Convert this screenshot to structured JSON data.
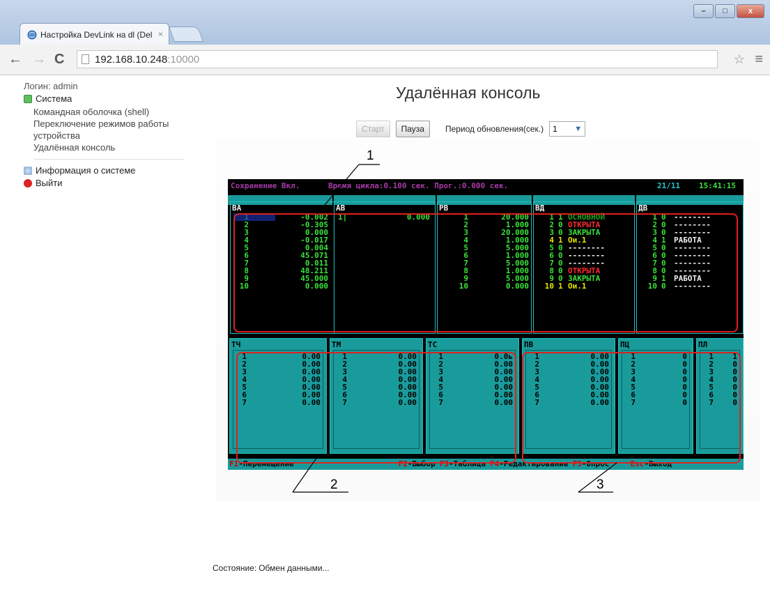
{
  "browser": {
    "tab_title": "Настройка DevLink на dl (Del",
    "tab_close": "×",
    "address_host": "192.168.10.248",
    "address_port": ":10000",
    "window_buttons": [
      "–",
      "□",
      "x"
    ]
  },
  "sidebar": {
    "login": "Логин: admin",
    "system_label": "Система",
    "items": [
      "Командная оболочка (shell)",
      "Переключение режимов работы устройства",
      "Удалённая консоль"
    ],
    "info_label": "Информация о системе",
    "logout_label": "Выйти"
  },
  "main": {
    "title": "Удалённая консоль",
    "start_label": "Старт",
    "pause_label": "Пауза",
    "period_label": "Период обновления(сек.)",
    "period_value": "1",
    "status_label": "Состояние:",
    "status_value": "Обмен данными..."
  },
  "console": {
    "save": "Сохранение Вкл.",
    "cycle": "Время цикла:0.100 сек. Прог.:0.000 сек.",
    "date": "21/11",
    "time": "15:41:15",
    "top_panels": {
      "ba": {
        "title": "ВА",
        "rows": [
          [
            "1",
            "-0.002"
          ],
          [
            "2",
            "-0.305"
          ],
          [
            "3",
            "0.000"
          ],
          [
            "4",
            "-0.017"
          ],
          [
            "5",
            "0.004"
          ],
          [
            "6",
            "45.071"
          ],
          [
            "7",
            "0.011"
          ],
          [
            "8",
            "48.211"
          ],
          [
            "9",
            "45.000"
          ],
          [
            "10",
            "0.000"
          ]
        ]
      },
      "ab": {
        "title": "АВ",
        "rows": [
          [
            "1|",
            "0.000"
          ]
        ]
      },
      "pb": {
        "title": "РВ",
        "rows": [
          [
            "1",
            "20.000"
          ],
          [
            "2",
            "1.000"
          ],
          [
            "3",
            "20.000"
          ],
          [
            "4",
            "1.000"
          ],
          [
            "5",
            "5.000"
          ],
          [
            "6",
            "1.000"
          ],
          [
            "7",
            "5.000"
          ],
          [
            "8",
            "1.000"
          ],
          [
            "9",
            "5.000"
          ],
          [
            "10",
            "0.000"
          ]
        ]
      },
      "vd": {
        "title": "ВД",
        "rows": [
          [
            "1",
            "1",
            "ОСНОВНОЙ",
            "dkgrn"
          ],
          [
            "2",
            "0",
            "ОТКРЫТА",
            "red"
          ],
          [
            "3",
            "0",
            "ЗАКРЫТА",
            "grn"
          ],
          [
            "4",
            "1",
            "Ои.1",
            "yel"
          ],
          [
            "5",
            "0",
            "--------",
            "wht"
          ],
          [
            "6",
            "0",
            "--------",
            "wht"
          ],
          [
            "7",
            "0",
            "--------",
            "wht"
          ],
          [
            "8",
            "0",
            "ОТКРЫТА",
            "red"
          ],
          [
            "9",
            "0",
            "ЗАКРЫТА",
            "grn"
          ],
          [
            "10",
            "1",
            "Ои.1",
            "yel"
          ]
        ]
      },
      "dv": {
        "title": "ДВ",
        "rows": [
          [
            "1",
            "0",
            "--------"
          ],
          [
            "2",
            "0",
            "--------"
          ],
          [
            "3",
            "0",
            "--------"
          ],
          [
            "4",
            "1",
            "РАБОТА"
          ],
          [
            "5",
            "0",
            "--------"
          ],
          [
            "6",
            "0",
            "--------"
          ],
          [
            "7",
            "0",
            "--------"
          ],
          [
            "8",
            "0",
            "--------"
          ],
          [
            "9",
            "1",
            "РАБОТА"
          ],
          [
            "10",
            "0",
            "--------"
          ]
        ]
      }
    },
    "bottom_panels": [
      {
        "key": "tch",
        "title": "ТЧ",
        "rows": [
          [
            "1",
            "0.00"
          ],
          [
            "2",
            "0.00"
          ],
          [
            "3",
            "0.00"
          ],
          [
            "4",
            "0.00"
          ],
          [
            "5",
            "0.00"
          ],
          [
            "6",
            "0.00"
          ],
          [
            "7",
            "0.00"
          ]
        ]
      },
      {
        "key": "tm",
        "title": "ТМ",
        "rows": [
          [
            "1",
            "0.00"
          ],
          [
            "2",
            "0.00"
          ],
          [
            "3",
            "0.00"
          ],
          [
            "4",
            "0.00"
          ],
          [
            "5",
            "0.00"
          ],
          [
            "6",
            "0.00"
          ],
          [
            "7",
            "0.00"
          ]
        ]
      },
      {
        "key": "tc",
        "title": "ТС",
        "rows": [
          [
            "1",
            "0.0ь"
          ],
          [
            "2",
            "0.00"
          ],
          [
            "3",
            "0.00"
          ],
          [
            "4",
            "0.00"
          ],
          [
            "5",
            "0.00"
          ],
          [
            "6",
            "0.00"
          ],
          [
            "7",
            "0.00"
          ]
        ]
      },
      {
        "key": "pv",
        "title": "ПВ",
        "rows": [
          [
            "1",
            "0.00"
          ],
          [
            "2",
            "0.00"
          ],
          [
            "3",
            "0.00"
          ],
          [
            "4",
            "0.00"
          ],
          [
            "5",
            "0.00"
          ],
          [
            "6",
            "0.00"
          ],
          [
            "7",
            "0.00"
          ]
        ]
      },
      {
        "key": "pc",
        "title": "ПЦ",
        "rows": [
          [
            "1",
            "0"
          ],
          [
            "2",
            "0"
          ],
          [
            "3",
            "0"
          ],
          [
            "4",
            "0"
          ],
          [
            "5",
            "0"
          ],
          [
            "6",
            "0"
          ],
          [
            "7",
            "0"
          ]
        ]
      },
      {
        "key": "pl",
        "title": "ПЛ",
        "rows": [
          [
            "1",
            "1"
          ],
          [
            "2",
            "0"
          ],
          [
            "3",
            "0"
          ],
          [
            "4",
            "0"
          ],
          [
            "5",
            "0"
          ],
          [
            "6",
            "0"
          ],
          [
            "7",
            "0"
          ]
        ]
      }
    ],
    "fkeys": [
      {
        "k": "F1",
        "t": "-Перемещение"
      },
      {
        "k": "F2",
        "t": "-Выбор"
      },
      {
        "k": "F3",
        "t": "-Таблица"
      },
      {
        "k": "F4",
        "t": "-Редактирование"
      },
      {
        "k": "F5",
        "t": "-Опрос"
      },
      {
        "k": "Esc",
        "t": "-Выход"
      }
    ]
  },
  "callouts": [
    "1",
    "2",
    "3"
  ],
  "colors": {
    "console_bg": "#000000",
    "teal": "#1a9b9b",
    "cyan": "#23c9c9",
    "highlight": "#e02020"
  }
}
